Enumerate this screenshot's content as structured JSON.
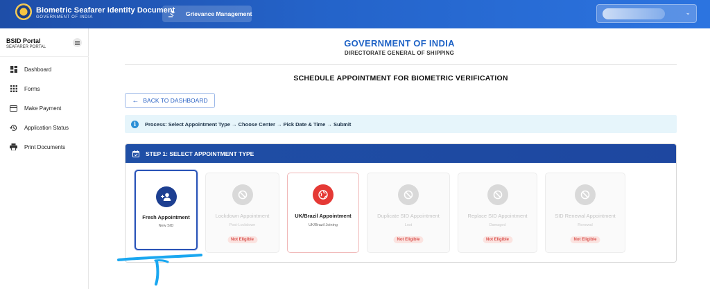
{
  "header": {
    "app_title": "Biometric Seafarer Identity Document",
    "app_subtitle": "GOVERNMENT OF INDIA",
    "grievance_label": "Grievance Management"
  },
  "sidebar": {
    "portal_title": "BSID Portal",
    "portal_subtitle": "SEAFARER PORTAL",
    "items": [
      {
        "label": "Dashboard",
        "icon": "dashboard-icon"
      },
      {
        "label": "Forms",
        "icon": "grid-icon"
      },
      {
        "label": "Make Payment",
        "icon": "credit-card-icon"
      },
      {
        "label": "Application Status",
        "icon": "history-icon"
      },
      {
        "label": "Print Documents",
        "icon": "printer-icon"
      }
    ]
  },
  "main": {
    "gov_title": "GOVERNMENT OF INDIA",
    "directorate": "DIRECTORATE GENERAL OF SHIPPING",
    "page_title": "SCHEDULE APPOINTMENT FOR BIOMETRIC VERIFICATION",
    "back_label": "BACK TO DASHBOARD",
    "process_text": "Process: Select Appointment Type → Choose Center → Pick Date & Time → Submit",
    "step_title": "STEP 1: SELECT APPOINTMENT TYPE",
    "options": [
      {
        "name": "Fresh Appointment",
        "sub": "New SID",
        "state": "selected",
        "icon": "person-add-icon"
      },
      {
        "name": "Lockdown Appointment",
        "sub": "Post-Lockdown",
        "state": "disabled",
        "badge": "Not Eligible",
        "icon": "block-icon"
      },
      {
        "name": "UK/Brazil Appointment",
        "sub": "UK/Brazil Joining",
        "state": "eligible",
        "icon": "globe-icon"
      },
      {
        "name": "Duplicate SID Appointment",
        "sub": "Lost",
        "state": "disabled",
        "badge": "Not Eligible",
        "icon": "block-icon"
      },
      {
        "name": "Replace SID Appointment",
        "sub": "Damaged",
        "state": "disabled",
        "badge": "Not Eligible",
        "icon": "block-icon"
      },
      {
        "name": "SID Renewal Appointment",
        "sub": "Renewal",
        "state": "disabled",
        "badge": "Not Eligible",
        "icon": "block-icon"
      }
    ]
  },
  "colors": {
    "header_blue": "#2463c9",
    "primary": "#1f4fa6",
    "title_blue": "#1f63c6",
    "uk_red": "#e53935",
    "badge_red": "#d9534f",
    "info_bg": "#e6f5fb",
    "annotation": "#1aa7f0"
  }
}
